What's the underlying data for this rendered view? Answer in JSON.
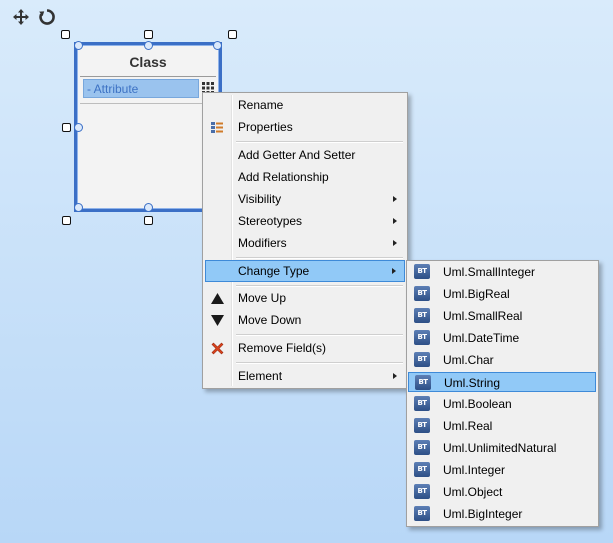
{
  "class_shape": {
    "title": "Class",
    "attribute": "- Attribute"
  },
  "context_menu": {
    "items": [
      {
        "label": "Rename",
        "icon": "",
        "submenu": false
      },
      {
        "label": "Properties",
        "icon": "properties-icon",
        "submenu": false
      },
      {
        "label": "Add Getter And Setter",
        "icon": "",
        "submenu": false
      },
      {
        "label": "Add Relationship",
        "icon": "",
        "submenu": false
      },
      {
        "label": "Visibility",
        "icon": "",
        "submenu": true
      },
      {
        "label": "Stereotypes",
        "icon": "",
        "submenu": true
      },
      {
        "label": "Modifiers",
        "icon": "",
        "submenu": true
      },
      {
        "label": "Change Type",
        "icon": "",
        "submenu": true,
        "active": true
      },
      {
        "label": "Move Up",
        "icon": "triangle-up-icon",
        "submenu": false
      },
      {
        "label": "Move Down",
        "icon": "triangle-down-icon",
        "submenu": false
      },
      {
        "label": "Remove Field(s)",
        "icon": "red-x-icon",
        "submenu": false
      },
      {
        "label": "Element",
        "icon": "",
        "submenu": true
      }
    ]
  },
  "change_type_submenu": {
    "icon_text": "BT",
    "selected": "Uml.String",
    "items": [
      "Uml.SmallInteger",
      "Uml.BigReal",
      "Uml.SmallReal",
      "Uml.DateTime",
      "Uml.Char",
      "Uml.String",
      "Uml.Boolean",
      "Uml.Real",
      "Uml.UnlimitedNatural",
      "Uml.Integer",
      "Uml.Object",
      "Uml.BigInteger"
    ]
  },
  "colors": {
    "highlight": "#91c9f7",
    "highlight_border": "#3e8ad8",
    "selection_border": "#3b6fc6",
    "remove_icon": "#d9441e"
  }
}
